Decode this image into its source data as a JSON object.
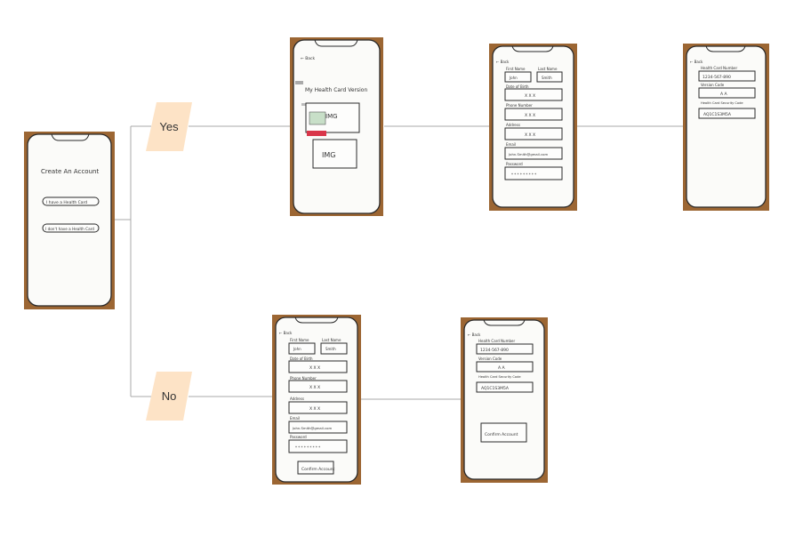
{
  "decisions": {
    "yes": "Yes",
    "no": "No"
  },
  "start": {
    "title": "Create An Account",
    "option_have": "I have a Health Card",
    "option_not": "I don't have a Health Card"
  },
  "yes_screen1": {
    "back": "← Back",
    "title": "My Health Card Version",
    "img1": "IMG",
    "img2": "IMG"
  },
  "account_form": {
    "back": "← Back",
    "first_name_label": "First Name",
    "first_name_value": "John",
    "last_name_label": "Last Name",
    "last_name_value": "Smith",
    "dob_label": "Date of Birth",
    "dob_value": "X X X",
    "phone_label": "Phone Number",
    "phone_value": "X X X",
    "address_label": "Address",
    "address_value": "X X X",
    "email_label": "Email",
    "email_value": "John.Smith@gmail.com",
    "password_label": "Password",
    "password_value": "* * * * * * * * *",
    "confirm_button": "Confirm Account"
  },
  "card_screen": {
    "back": "← Back",
    "card_number_label": "Health Card Number",
    "card_number_value": "1234-567-890",
    "version_label": "Version Code",
    "version_value": "A A",
    "security_label": "Health Card Security Code",
    "security_value": "AQ1C1S3M5A",
    "confirm_button": "Confirm Account"
  },
  "colors": {
    "decision_fill": "#fde3c6",
    "connector": "#a9a9a9",
    "photo_background": "#9c6633"
  }
}
